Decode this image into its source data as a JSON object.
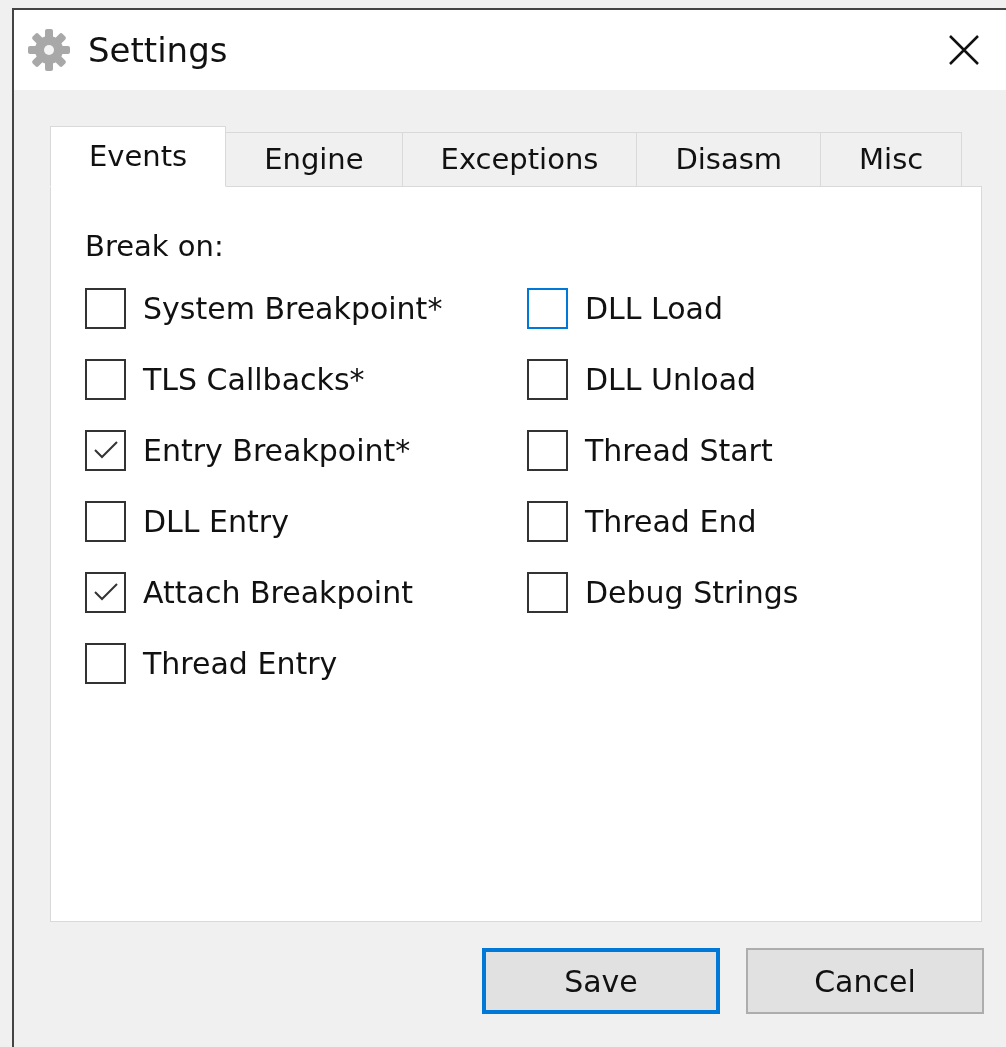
{
  "window": {
    "title": "Settings"
  },
  "tabs": [
    {
      "label": "Events",
      "selected": true
    },
    {
      "label": "Engine",
      "selected": false
    },
    {
      "label": "Exceptions",
      "selected": false
    },
    {
      "label": "Disasm",
      "selected": false
    },
    {
      "label": "Misc",
      "selected": false
    }
  ],
  "group_label": "Break on:",
  "columns": [
    [
      {
        "label": "System Breakpoint*",
        "checked": false,
        "focused": false
      },
      {
        "label": "TLS Callbacks*",
        "checked": false,
        "focused": false
      },
      {
        "label": "Entry Breakpoint*",
        "checked": true,
        "focused": false
      },
      {
        "label": "DLL Entry",
        "checked": false,
        "focused": false
      },
      {
        "label": "Attach Breakpoint",
        "checked": true,
        "focused": false
      },
      {
        "label": "Thread Entry",
        "checked": false,
        "focused": false
      }
    ],
    [
      {
        "label": "DLL Load",
        "checked": false,
        "focused": true
      },
      {
        "label": "DLL Unload",
        "checked": false,
        "focused": false
      },
      {
        "label": "Thread Start",
        "checked": false,
        "focused": false
      },
      {
        "label": "Thread End",
        "checked": false,
        "focused": false
      },
      {
        "label": "Debug Strings",
        "checked": false,
        "focused": false
      }
    ]
  ],
  "buttons": [
    {
      "label": "Save",
      "default": true
    },
    {
      "label": "Cancel",
      "default": false
    }
  ]
}
